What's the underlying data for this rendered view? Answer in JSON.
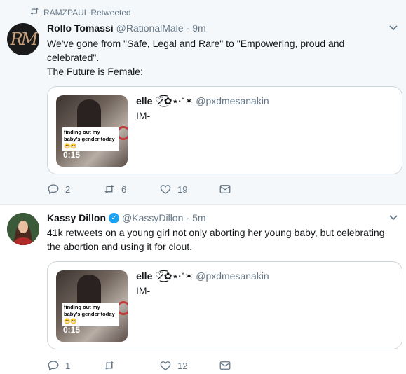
{
  "tweets": [
    {
      "retweet_notice": "RAMZPAUL Retweeted",
      "avatar_text": "RM",
      "name": "Rollo Tomassi",
      "handle": "@RationalMale",
      "time": "9m",
      "text_line1": "We've gone from \"Safe, Legal and Rare\" to \"Empowering, proud and celebrated\".",
      "text_line2": "The Future is Female:",
      "quote": {
        "name": "elle ♡̷̷͜͡✿⋆·˚✶",
        "handle": "@pxdmesanakin",
        "text": "IM-",
        "video_caption": "finding out my baby's gender today 😬😬",
        "video_duration": "0:15"
      },
      "actions": {
        "replies": "2",
        "retweets": "6",
        "likes": "19"
      }
    },
    {
      "name": "Kassy Dillon",
      "verified": true,
      "handle": "@KassyDillon",
      "time": "5m",
      "text": "41k retweets on a young girl not only aborting her young baby, but celebrating the abortion and using it for clout.",
      "quote": {
        "name": "elle ♡̷̷͜͡✿⋆·˚✶",
        "handle": "@pxdmesanakin",
        "text": "IM-",
        "video_caption": "finding out my baby's gender today 😬😬",
        "video_duration": "0:15"
      },
      "actions": {
        "replies": "1",
        "retweets": "",
        "likes": "12"
      }
    }
  ],
  "colors": {
    "accent": "#1da1f2",
    "muted": "#657786",
    "border": "#ccd6dd"
  }
}
